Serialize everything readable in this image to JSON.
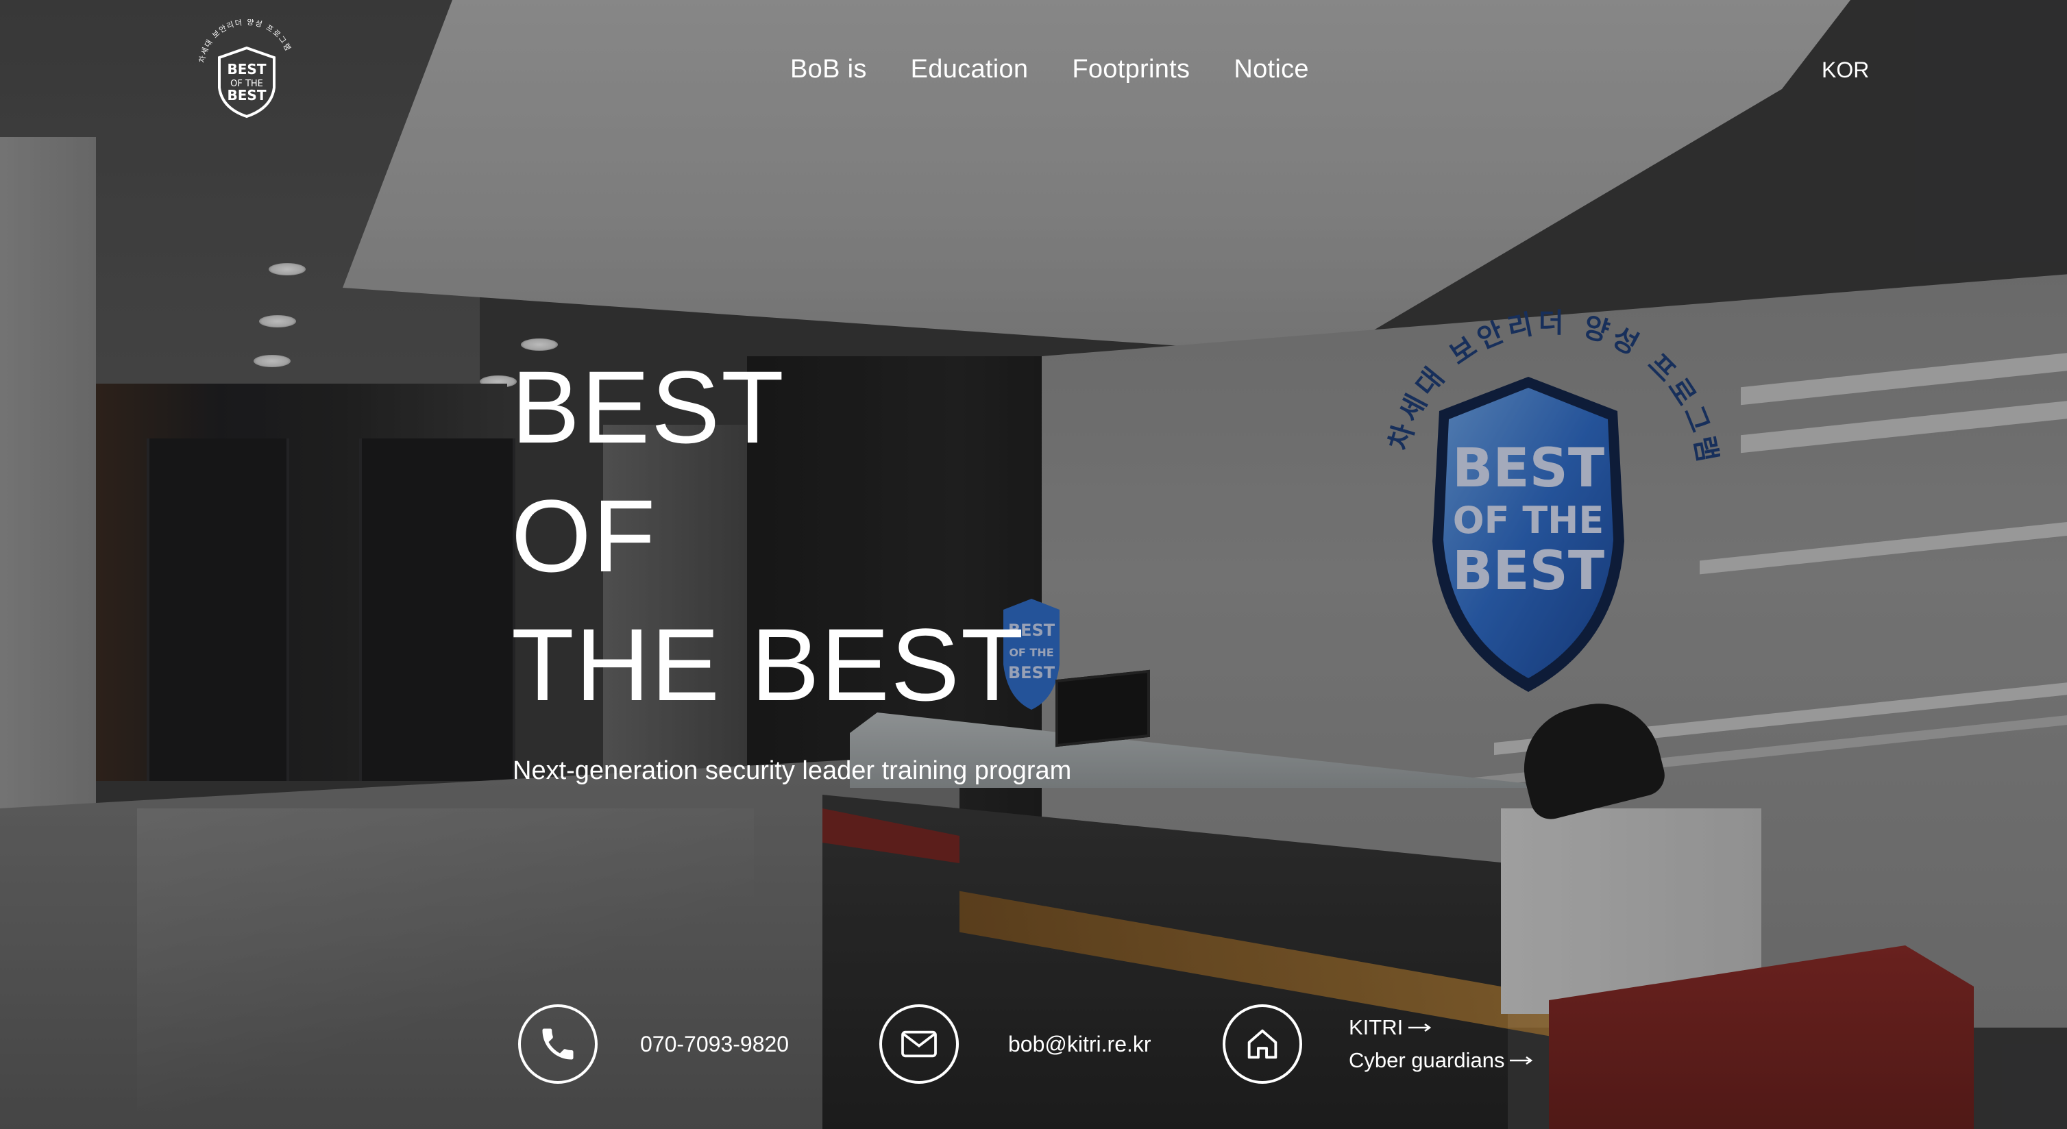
{
  "header": {
    "logo": {
      "text_lines": [
        "BEST",
        "OF THE",
        "BEST"
      ],
      "ring_text": "차세대 보안리더 양성 프로그램"
    },
    "nav": [
      {
        "label": "BoB is"
      },
      {
        "label": "Education"
      },
      {
        "label": "Footprints"
      },
      {
        "label": "Notice"
      }
    ],
    "language": "KOR"
  },
  "hero": {
    "title_lines": [
      "BEST",
      "OF",
      "THE BEST"
    ],
    "subtitle": "Next-generation security leader training program"
  },
  "background": {
    "wall_ring_text": "차세대 보안리더 양성 프로그램",
    "wall_shield_lines": [
      "BEST",
      "OF THE",
      "BEST"
    ]
  },
  "contact": {
    "phone": {
      "icon": "phone-icon",
      "value": "070-7093-9820"
    },
    "email": {
      "icon": "mail-icon",
      "value": "bob@kitri.re.kr"
    },
    "links": {
      "icon": "home-icon",
      "items": [
        {
          "label": "KITRI",
          "icon": "arrow-right-icon"
        },
        {
          "label": "Cyber guardians",
          "icon": "arrow-right-icon"
        }
      ]
    }
  },
  "colors": {
    "text": "#ffffff",
    "shield_blue": "#2f6fd0",
    "desk_red": "#8d2a26"
  }
}
